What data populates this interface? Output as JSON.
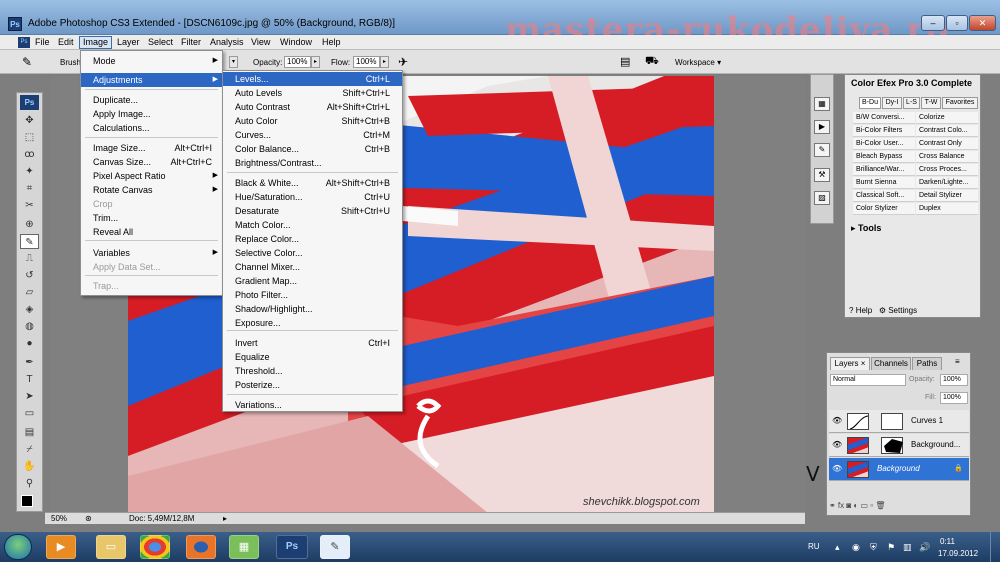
{
  "window": {
    "title": "Adobe Photoshop CS3 Extended - [DSCN6109c.jpg @ 50% (Background, RGB/8)]",
    "app_icon": "Ps",
    "controls": [
      "–",
      "▫",
      "✕"
    ]
  },
  "watermark": "mastera-rukodeliya.ru",
  "menubar": [
    "File",
    "Edit",
    "Image",
    "Layer",
    "Select",
    "Filter",
    "Analysis",
    "View",
    "Window",
    "Help"
  ],
  "options": {
    "brush_label": "Brush",
    "opacity_label": "Opacity:",
    "opacity_value": "100%",
    "flow_label": "Flow:",
    "flow_value": "100%",
    "workspace_label": "Workspace ▾"
  },
  "image_menu": [
    {
      "label": "Mode",
      "arrow": "▶"
    },
    {
      "label": "Adjustments",
      "arrow": "▶",
      "highlight": true
    },
    {
      "label": "Duplicate..."
    },
    {
      "label": "Apply Image..."
    },
    {
      "label": "Calculations..."
    },
    {
      "label": "Image Size...",
      "shortcut": "Alt+Ctrl+I"
    },
    {
      "label": "Canvas Size...",
      "shortcut": "Alt+Ctrl+C"
    },
    {
      "label": "Pixel Aspect Ratio",
      "arrow": "▶"
    },
    {
      "label": "Rotate Canvas",
      "arrow": "▶"
    },
    {
      "label": "Crop",
      "disabled": true
    },
    {
      "label": "Trim..."
    },
    {
      "label": "Reveal All"
    },
    {
      "label": "Variables",
      "arrow": "▶"
    },
    {
      "label": "Apply Data Set...",
      "disabled": true
    },
    {
      "label": "Trap...",
      "disabled": true
    }
  ],
  "adjustments_menu": [
    {
      "label": "Levels...",
      "shortcut": "Ctrl+L",
      "highlight": true
    },
    {
      "label": "Auto Levels",
      "shortcut": "Shift+Ctrl+L"
    },
    {
      "label": "Auto Contrast",
      "shortcut": "Alt+Shift+Ctrl+L"
    },
    {
      "label": "Auto Color",
      "shortcut": "Shift+Ctrl+B"
    },
    {
      "label": "Curves...",
      "shortcut": "Ctrl+M"
    },
    {
      "label": "Color Balance...",
      "shortcut": "Ctrl+B"
    },
    {
      "label": "Brightness/Contrast..."
    },
    {
      "label": "Black & White...",
      "shortcut": "Alt+Shift+Ctrl+B"
    },
    {
      "label": "Hue/Saturation...",
      "shortcut": "Ctrl+U"
    },
    {
      "label": "Desaturate",
      "shortcut": "Shift+Ctrl+U"
    },
    {
      "label": "Match Color..."
    },
    {
      "label": "Replace Color..."
    },
    {
      "label": "Selective Color..."
    },
    {
      "label": "Channel Mixer..."
    },
    {
      "label": "Gradient Map..."
    },
    {
      "label": "Photo Filter..."
    },
    {
      "label": "Shadow/Highlight..."
    },
    {
      "label": "Exposure..."
    },
    {
      "label": "Invert",
      "shortcut": "Ctrl+I"
    },
    {
      "label": "Equalize"
    },
    {
      "label": "Threshold..."
    },
    {
      "label": "Posterize..."
    },
    {
      "label": "Variations..."
    }
  ],
  "photo_credit": "shevchikk.blogspot.com",
  "status": {
    "zoom": "50%",
    "doc": "Doc: 5,49M/12,8M"
  },
  "efex": {
    "title": "Color Efex Pro 3.0 Complete",
    "tabs": [
      "B-Du",
      "Dy-I",
      "L-S",
      "T-W",
      "Favorites"
    ],
    "filters": [
      [
        "B/W Conversi...",
        "Colorize"
      ],
      [
        "Bi-Color Filters",
        "Contrast Colo..."
      ],
      [
        "Bi-Color User...",
        "Contrast Only"
      ],
      [
        "Bleach Bypass",
        "Cross Balance"
      ],
      [
        "Brilliance/War...",
        "Cross Proces..."
      ],
      [
        "Burnt Sienna",
        "Darken/Lighte..."
      ],
      [
        "Classical Soft...",
        "Detail Stylizer"
      ],
      [
        "Color Stylizer",
        "Duplex"
      ]
    ],
    "tools_label": "Tools",
    "help_label": "Help",
    "settings_label": "Settings"
  },
  "layers_panel": {
    "tabs": [
      "Layers ×",
      "Channels",
      "Paths"
    ],
    "blend_mode": "Normal",
    "opacity_label": "Opacity:",
    "opacity_value": "100%",
    "fill_label": "Fill:",
    "fill_value": "100%",
    "layers": [
      {
        "name": "Curves 1"
      },
      {
        "name": "Background..."
      },
      {
        "name": "Background",
        "selected": true
      }
    ],
    "footer": "⚭  fx  ◙  ◐  ▭  ▫  🗑"
  },
  "taskbar": {
    "ps_button": "Ps",
    "language": "RU",
    "time": "0:11",
    "date": "17.09.2012"
  },
  "annotation_mark": "V"
}
